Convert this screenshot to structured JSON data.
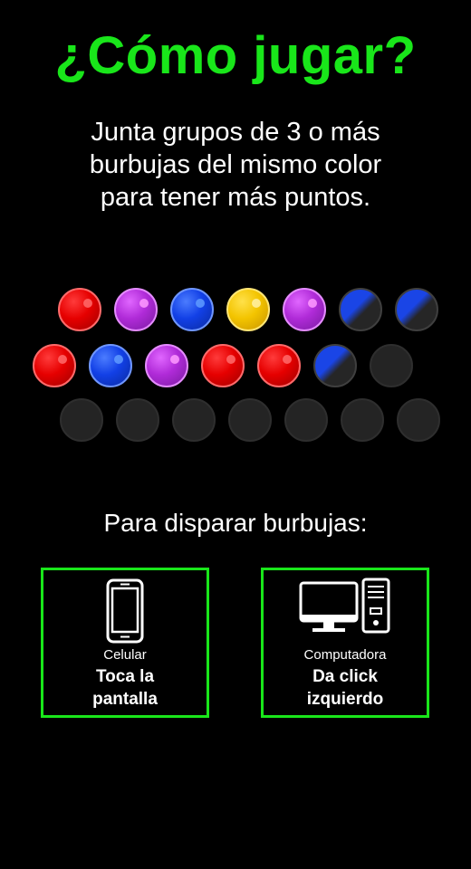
{
  "title": "¿Cómo jugar?",
  "intro": {
    "line1": "Junta grupos de 3 o más",
    "line2": "burbujas del mismo color",
    "line3": "para tener más puntos."
  },
  "board": {
    "rows": [
      [
        "red",
        "purple",
        "blue",
        "yellow",
        "purple",
        "cracked",
        "cracked"
      ],
      [
        "red",
        "blue",
        "purple",
        "red",
        "red",
        "cracked",
        "empty"
      ],
      [
        "empty",
        "empty",
        "empty",
        "empty",
        "empty",
        "empty",
        "empty"
      ]
    ]
  },
  "instructions": {
    "label": "Para disparar burbujas:",
    "mobile": {
      "icon": "mobile-phone-icon",
      "device": "Celular",
      "action_line1": "Toca la",
      "action_line2": "pantalla"
    },
    "desktop": {
      "icon": "desktop-computer-icon",
      "device": "Computadora",
      "action_line1": "Da click",
      "action_line2": "izquierdo"
    }
  },
  "colors": {
    "accent_green": "#19e61a",
    "background": "#000000",
    "text": "#ffffff"
  }
}
